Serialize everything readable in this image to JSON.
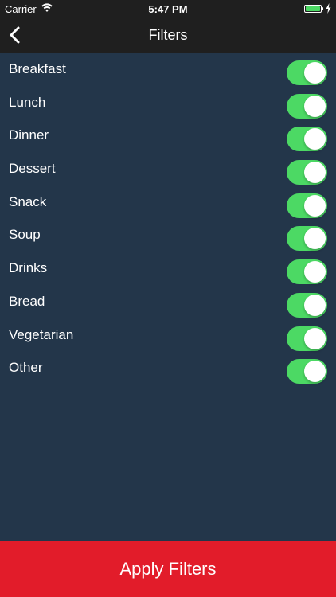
{
  "status_bar": {
    "carrier": "Carrier",
    "time": "5:47 PM",
    "battery_color": "#4cd964"
  },
  "nav": {
    "title": "Filters",
    "back_icon": "chevron-left-icon"
  },
  "filters": [
    {
      "label": "Breakfast",
      "enabled": true
    },
    {
      "label": "Lunch",
      "enabled": true
    },
    {
      "label": "Dinner",
      "enabled": true
    },
    {
      "label": "Dessert",
      "enabled": true
    },
    {
      "label": "Snack",
      "enabled": true
    },
    {
      "label": "Soup",
      "enabled": true
    },
    {
      "label": "Drinks",
      "enabled": true
    },
    {
      "label": "Bread",
      "enabled": true
    },
    {
      "label": "Vegetarian",
      "enabled": true
    },
    {
      "label": "Other",
      "enabled": true
    }
  ],
  "apply_button": {
    "label": "Apply Filters",
    "color": "#e21c2a"
  },
  "colors": {
    "background": "#23364a",
    "nav_background": "#1f1f1f",
    "toggle_on": "#4cd964"
  }
}
